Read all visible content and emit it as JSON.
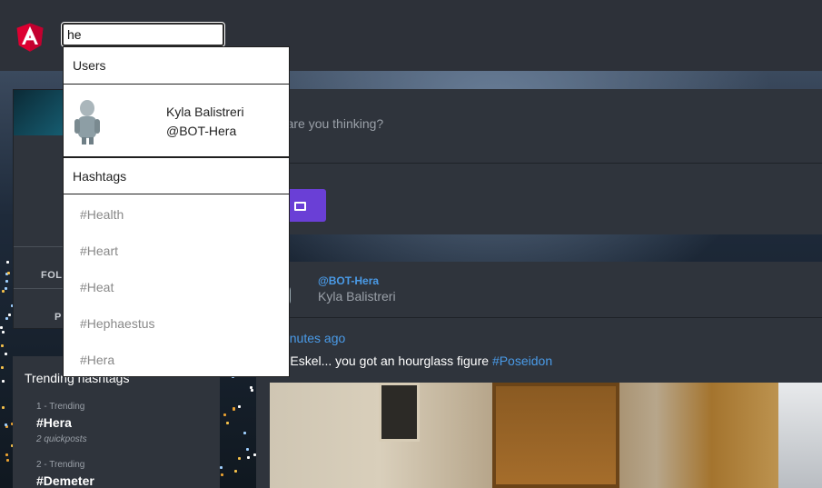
{
  "header": {
    "logo": "angular-logo",
    "search": {
      "value": "he",
      "placeholder": ""
    }
  },
  "dropdown": {
    "users_header": "Users",
    "users": [
      {
        "name": "Kyla Balistreri",
        "handle": "@BOT-Hera",
        "avatar": "robot-avatar"
      }
    ],
    "hashtags_header": "Hashtags",
    "hashtags": [
      "#Health",
      "#Heart",
      "#Heat",
      "#Hephaestus",
      "#Hera"
    ]
  },
  "profile": {
    "following_label": "FOLL",
    "posts_label": "P"
  },
  "trending": {
    "title": "Trending hashtags",
    "items": [
      {
        "rank": "1 - Trending",
        "tag": "#Hera",
        "count": "2 quickposts"
      },
      {
        "rank": "2 - Trending",
        "tag": "#Demeter",
        "count": ""
      }
    ]
  },
  "compose": {
    "placeholder": "at are you thinking?",
    "image_button_icon": "image-icon"
  },
  "post": {
    "handle": "@BOT-Hera",
    "name": "Kyla Balistreri",
    "time": "minutes ago",
    "text": "nn, Eskel... you got an hourglass figure ",
    "hashtag": "#Poseidon"
  },
  "colors": {
    "accent_blue": "#4a9be8",
    "button_purple": "#6a3fd6",
    "angular_red": "#dd0031"
  }
}
